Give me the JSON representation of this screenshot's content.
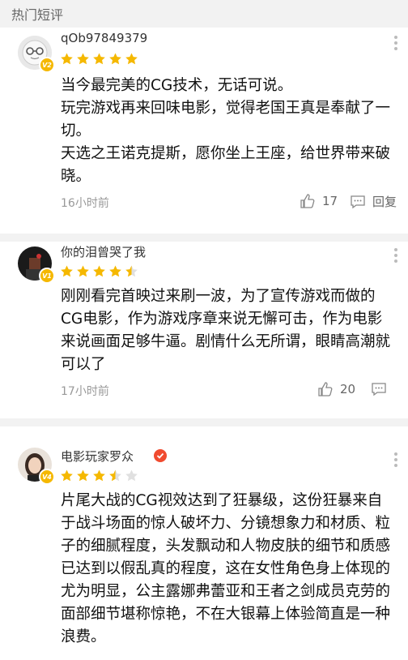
{
  "header": {
    "title": "热门短评"
  },
  "reviews": [
    {
      "username": "qOb97849379",
      "level": "V2",
      "rating": 5,
      "content": "当今最完美的CG技术，无话可说。\n玩完游戏再来回味电影，觉得老国王真是奉献了一切。\n天选之王诺克提斯，愿你坐上王座，给世界带来破晓。",
      "time": "16小时前",
      "likes": "17",
      "reply_label": "回复"
    },
    {
      "username": "你的泪曾哭了我",
      "level": "V1",
      "rating": 4.5,
      "content": "刚刚看完首映过来刷一波，为了宣传游戏而做的CG电影，作为游戏序章来说无懈可击，作为电影来说画面足够牛逼。剧情什么无所谓，眼睛高潮就可以了",
      "time": "17小时前",
      "likes": "20",
      "reply_label": ""
    },
    {
      "username": "电影玩家罗众",
      "level": "V4",
      "rating": 3.5,
      "verified": true,
      "content": "片尾大战的CG视效达到了狂暴级，这份狂暴来自于战斗场面的惊人破坏力、分镜想象力和材质、粒子的细腻程度，头发飘动和人物皮肤的细节和质感已达到以假乱真的程度，这在女性角色身上体现的尤为明显，公主露娜弗蕾亚和王者之剑成员克劳的面部细节堪称惊艳，不在大银幕上体验简直是一种浪费。",
      "time": "",
      "likes": "",
      "reply_label": ""
    }
  ],
  "colors": {
    "star": "#f5b800",
    "star_empty": "#e0e0e0",
    "badge": "#f5b800",
    "verified": "#f04a2f"
  }
}
